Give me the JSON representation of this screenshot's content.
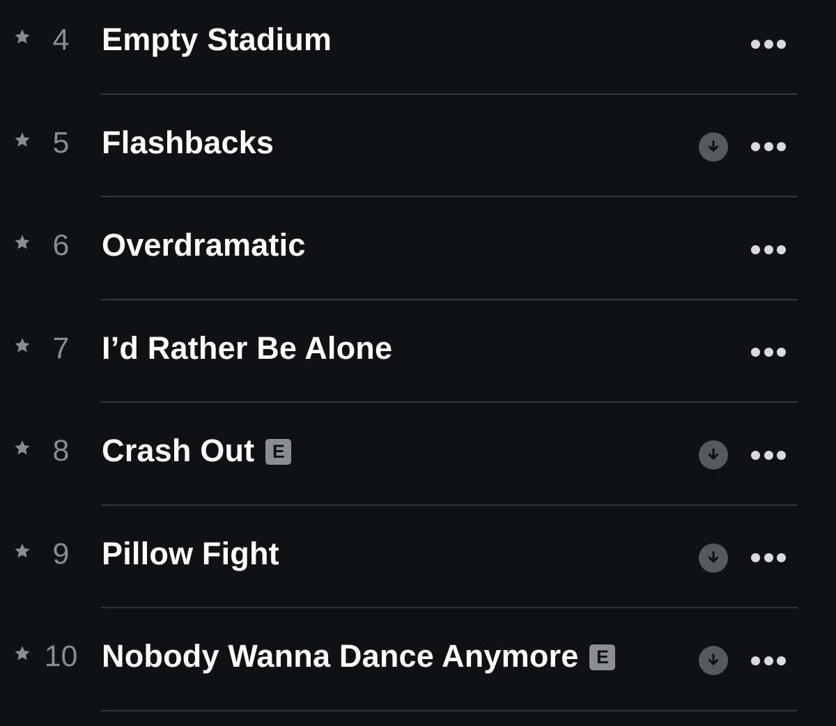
{
  "icons": {
    "star": "star-icon",
    "download": "download-icon",
    "more": "more-icon"
  },
  "explicit_label": "E",
  "tracks": [
    {
      "number": "4",
      "title": "Empty Stadium",
      "explicit": false,
      "downloadable": false
    },
    {
      "number": "5",
      "title": "Flashbacks",
      "explicit": false,
      "downloadable": true
    },
    {
      "number": "6",
      "title": "Overdramatic",
      "explicit": false,
      "downloadable": false
    },
    {
      "number": "7",
      "title": "I’d Rather Be Alone",
      "explicit": false,
      "downloadable": false
    },
    {
      "number": "8",
      "title": "Crash Out",
      "explicit": true,
      "downloadable": true
    },
    {
      "number": "9",
      "title": "Pillow Fight",
      "explicit": false,
      "downloadable": true
    },
    {
      "number": "10",
      "title": "Nobody Wanna Dance Anymore",
      "explicit": true,
      "downloadable": true
    }
  ]
}
